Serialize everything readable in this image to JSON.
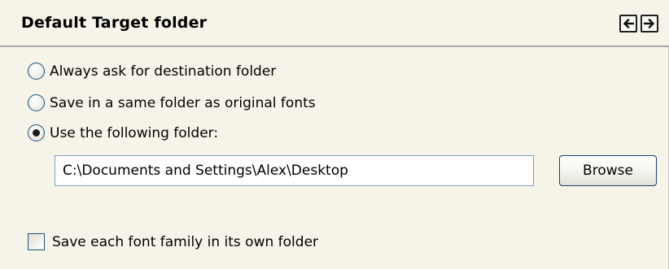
{
  "header": {
    "title": "Default Target folder",
    "prev_icon": "arrow-left-icon",
    "next_icon": "arrow-right-icon"
  },
  "destination_options": [
    {
      "label": "Always ask for destination folder",
      "selected": false
    },
    {
      "label": "Save in a same folder as original fonts",
      "selected": false
    },
    {
      "label": "Use the following folder:",
      "selected": true
    }
  ],
  "folder": {
    "path": "C:\\Documents and Settings\\Alex\\Desktop",
    "browse_label": "Browse"
  },
  "family_folder": {
    "label": "Save each font family in its own folder",
    "checked": false
  }
}
